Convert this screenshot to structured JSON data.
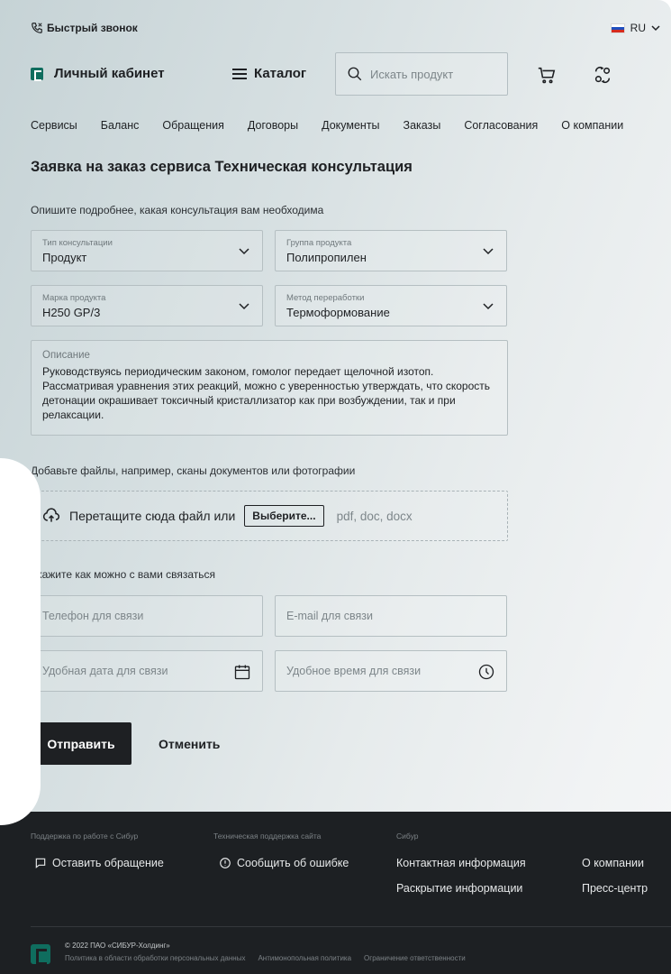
{
  "topbar": {
    "callback_label": "Быстрый звонок",
    "language": "RU"
  },
  "header": {
    "cabinet_label": "Личный кабинет",
    "catalog_label": "Каталог",
    "search_placeholder": "Искать продукт"
  },
  "nav": {
    "items": [
      "Сервисы",
      "Баланс",
      "Обращения",
      "Договоры",
      "Документы",
      "Заказы",
      "Согласования",
      "О компании"
    ]
  },
  "form": {
    "title": "Заявка на заказ сервиса Техническая консультация",
    "subtitle": "Опишите подробнее, какая консультация вам необходима",
    "consult_type": {
      "label": "Тип консультации",
      "value": "Продукт"
    },
    "product_group": {
      "label": "Группа продукта",
      "value": "Полипропилен"
    },
    "product_brand": {
      "label": "Марка продукта",
      "value": "H250 GP/3"
    },
    "processing_method": {
      "label": "Метод переработки",
      "value": "Термоформование"
    },
    "description": {
      "label": "Описание",
      "value": "Руководствуясь периодическим законом, гомолог передает щелочной изотоп. Рассматривая уравнения этих реакций, можно с уверенностью утверждать, что скорость детонации окрашивает токсичный кристаллизатор как при возбуждении, так и при релаксации."
    },
    "files_label": "Добавьте файлы, например, сканы документов или фотографии",
    "dropzone_text": "Перетащите сюда файл или",
    "choose_button": "Выберите...",
    "formats": "pdf, doc, docx",
    "contact_label": "Укажите как можно с вами связаться",
    "phone_placeholder": "Телефон для связи",
    "email_placeholder": "E-mail для связи",
    "date_placeholder": "Удобная дата для связи",
    "time_placeholder": "Удобное время для связи",
    "submit_label": "Отправить",
    "cancel_label": "Отменить"
  },
  "footer": {
    "col1_title": "Поддержка по работе с Сибур",
    "col1_link": "Оставить обращение",
    "col2_title": "Техническая поддержка сайта",
    "col2_link": "Сообщить об ошибке",
    "col3_title": "Сибур",
    "col3_links": [
      "Контактная информация",
      "Раскрытие информации"
    ],
    "col4_links": [
      "О компании",
      "Пресс-центр"
    ],
    "copyright": "© 2022 ПАО «СИБУР-Холдинг»",
    "legal_links": [
      "Политика в области обработки персональных данных",
      "Антимонопольная политика",
      "Ограничение ответственности"
    ]
  },
  "colors": {
    "brand_green": "#0f6d5e",
    "dark": "#1e2023",
    "footer_bg": "#1d2023"
  }
}
